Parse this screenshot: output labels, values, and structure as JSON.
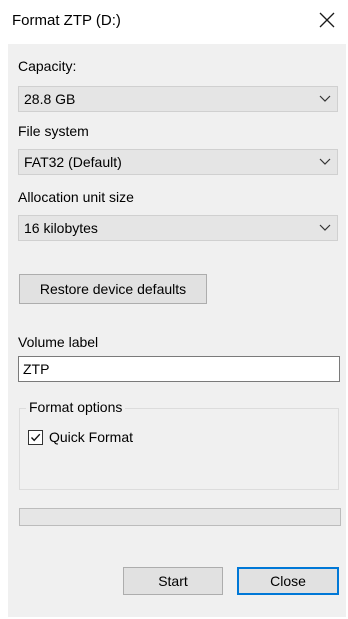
{
  "window": {
    "title": "Format ZTP (D:)"
  },
  "capacity": {
    "label": "Capacity:",
    "value": "28.8 GB"
  },
  "file_system": {
    "label": "File system",
    "value": "FAT32 (Default)"
  },
  "allocation": {
    "label": "Allocation unit size",
    "value": "16 kilobytes"
  },
  "restore_button": {
    "label": "Restore device defaults"
  },
  "volume": {
    "label": "Volume label",
    "value": "ZTP"
  },
  "format_options": {
    "title": "Format options",
    "quick_format_label": "Quick Format",
    "quick_format_checked": true
  },
  "progress": {
    "value_percent": 0
  },
  "buttons": {
    "start": "Start",
    "close": "Close"
  },
  "icons": {
    "close": "close-icon",
    "dropdown": "chevron-down-icon",
    "check": "checkmark-icon"
  },
  "colors": {
    "accent": "#0078d7",
    "dialog_background": "#f0f0f0",
    "progress_fill": "#06b025"
  }
}
